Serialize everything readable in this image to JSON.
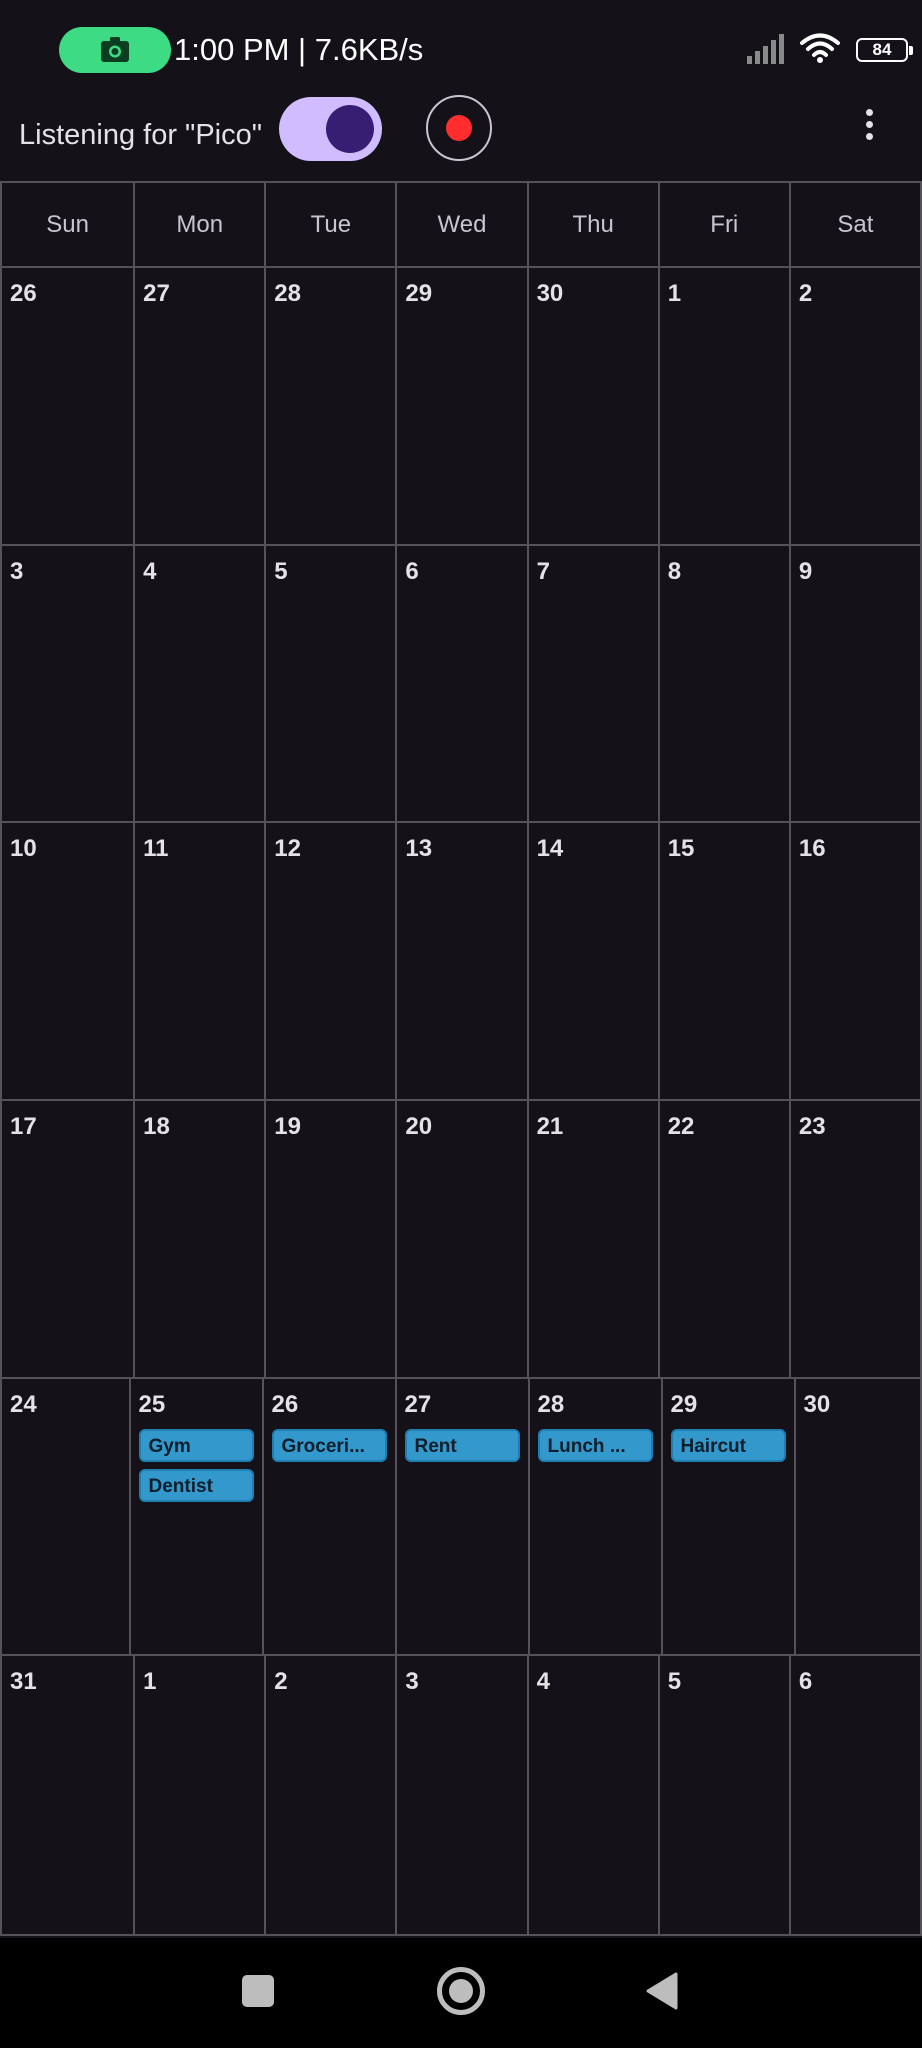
{
  "status_bar": {
    "time_speed": "1:00 PM | 7.6KB/s",
    "battery": "84",
    "icons": [
      "camera-icon",
      "signal-icon",
      "wifi-icon",
      "battery-icon"
    ]
  },
  "app_bar": {
    "listening_label": "Listening for \"Pico\"",
    "toggle_on": true,
    "icons": [
      "record-icon",
      "more-vert-icon"
    ]
  },
  "calendar": {
    "weekdays": [
      "Sun",
      "Mon",
      "Tue",
      "Wed",
      "Thu",
      "Fri",
      "Sat"
    ],
    "weeks": [
      [
        {
          "day": "26"
        },
        {
          "day": "27"
        },
        {
          "day": "28"
        },
        {
          "day": "29"
        },
        {
          "day": "30"
        },
        {
          "day": "1"
        },
        {
          "day": "2"
        }
      ],
      [
        {
          "day": "3"
        },
        {
          "day": "4"
        },
        {
          "day": "5"
        },
        {
          "day": "6"
        },
        {
          "day": "7"
        },
        {
          "day": "8"
        },
        {
          "day": "9"
        }
      ],
      [
        {
          "day": "10"
        },
        {
          "day": "11"
        },
        {
          "day": "12"
        },
        {
          "day": "13"
        },
        {
          "day": "14"
        },
        {
          "day": "15"
        },
        {
          "day": "16"
        }
      ],
      [
        {
          "day": "17"
        },
        {
          "day": "18"
        },
        {
          "day": "19"
        },
        {
          "day": "20"
        },
        {
          "day": "21"
        },
        {
          "day": "22"
        },
        {
          "day": "23"
        }
      ],
      [
        {
          "day": "24"
        },
        {
          "day": "25",
          "events": [
            "Gym",
            "Dentist"
          ]
        },
        {
          "day": "26",
          "events": [
            "Groceri..."
          ]
        },
        {
          "day": "27",
          "events": [
            "Rent"
          ]
        },
        {
          "day": "28",
          "events": [
            "Lunch ..."
          ]
        },
        {
          "day": "29",
          "events": [
            "Haircut"
          ]
        },
        {
          "day": "30"
        }
      ],
      [
        {
          "day": "31"
        },
        {
          "day": "1"
        },
        {
          "day": "2"
        },
        {
          "day": "3"
        },
        {
          "day": "4"
        },
        {
          "day": "5"
        },
        {
          "day": "6"
        }
      ]
    ]
  },
  "colors": {
    "background": "#141218",
    "event": "#3399cc",
    "toggle_track": "#d0bcff",
    "toggle_knob": "#381e72",
    "record_dot": "#ff2d2d",
    "recorder_pill": "#3ddc84"
  },
  "nav_bar": {
    "icons": [
      "recents-square-icon",
      "home-circle-icon",
      "back-triangle-icon"
    ]
  }
}
